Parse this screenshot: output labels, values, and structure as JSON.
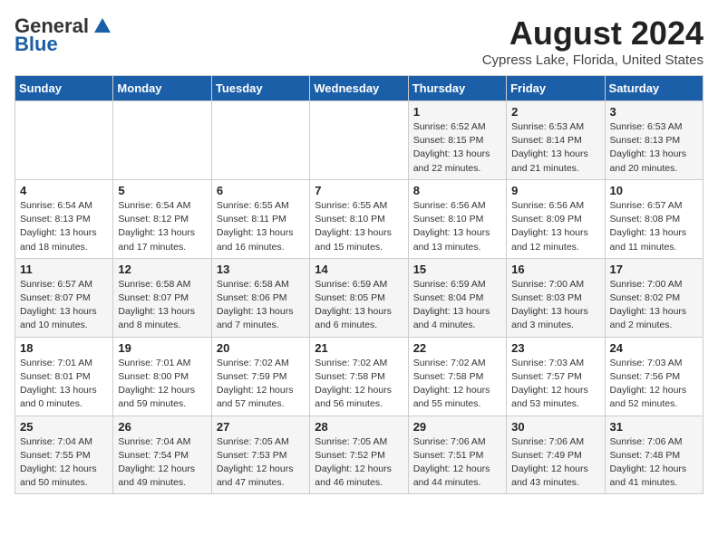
{
  "header": {
    "logo_general": "General",
    "logo_blue": "Blue",
    "title": "August 2024",
    "subtitle": "Cypress Lake, Florida, United States"
  },
  "calendar": {
    "days_of_week": [
      "Sunday",
      "Monday",
      "Tuesday",
      "Wednesday",
      "Thursday",
      "Friday",
      "Saturday"
    ],
    "weeks": [
      [
        {
          "day": "",
          "info": ""
        },
        {
          "day": "",
          "info": ""
        },
        {
          "day": "",
          "info": ""
        },
        {
          "day": "",
          "info": ""
        },
        {
          "day": "1",
          "info": "Sunrise: 6:52 AM\nSunset: 8:15 PM\nDaylight: 13 hours\nand 22 minutes."
        },
        {
          "day": "2",
          "info": "Sunrise: 6:53 AM\nSunset: 8:14 PM\nDaylight: 13 hours\nand 21 minutes."
        },
        {
          "day": "3",
          "info": "Sunrise: 6:53 AM\nSunset: 8:13 PM\nDaylight: 13 hours\nand 20 minutes."
        }
      ],
      [
        {
          "day": "4",
          "info": "Sunrise: 6:54 AM\nSunset: 8:13 PM\nDaylight: 13 hours\nand 18 minutes."
        },
        {
          "day": "5",
          "info": "Sunrise: 6:54 AM\nSunset: 8:12 PM\nDaylight: 13 hours\nand 17 minutes."
        },
        {
          "day": "6",
          "info": "Sunrise: 6:55 AM\nSunset: 8:11 PM\nDaylight: 13 hours\nand 16 minutes."
        },
        {
          "day": "7",
          "info": "Sunrise: 6:55 AM\nSunset: 8:10 PM\nDaylight: 13 hours\nand 15 minutes."
        },
        {
          "day": "8",
          "info": "Sunrise: 6:56 AM\nSunset: 8:10 PM\nDaylight: 13 hours\nand 13 minutes."
        },
        {
          "day": "9",
          "info": "Sunrise: 6:56 AM\nSunset: 8:09 PM\nDaylight: 13 hours\nand 12 minutes."
        },
        {
          "day": "10",
          "info": "Sunrise: 6:57 AM\nSunset: 8:08 PM\nDaylight: 13 hours\nand 11 minutes."
        }
      ],
      [
        {
          "day": "11",
          "info": "Sunrise: 6:57 AM\nSunset: 8:07 PM\nDaylight: 13 hours\nand 10 minutes."
        },
        {
          "day": "12",
          "info": "Sunrise: 6:58 AM\nSunset: 8:07 PM\nDaylight: 13 hours\nand 8 minutes."
        },
        {
          "day": "13",
          "info": "Sunrise: 6:58 AM\nSunset: 8:06 PM\nDaylight: 13 hours\nand 7 minutes."
        },
        {
          "day": "14",
          "info": "Sunrise: 6:59 AM\nSunset: 8:05 PM\nDaylight: 13 hours\nand 6 minutes."
        },
        {
          "day": "15",
          "info": "Sunrise: 6:59 AM\nSunset: 8:04 PM\nDaylight: 13 hours\nand 4 minutes."
        },
        {
          "day": "16",
          "info": "Sunrise: 7:00 AM\nSunset: 8:03 PM\nDaylight: 13 hours\nand 3 minutes."
        },
        {
          "day": "17",
          "info": "Sunrise: 7:00 AM\nSunset: 8:02 PM\nDaylight: 13 hours\nand 2 minutes."
        }
      ],
      [
        {
          "day": "18",
          "info": "Sunrise: 7:01 AM\nSunset: 8:01 PM\nDaylight: 13 hours\nand 0 minutes."
        },
        {
          "day": "19",
          "info": "Sunrise: 7:01 AM\nSunset: 8:00 PM\nDaylight: 12 hours\nand 59 minutes."
        },
        {
          "day": "20",
          "info": "Sunrise: 7:02 AM\nSunset: 7:59 PM\nDaylight: 12 hours\nand 57 minutes."
        },
        {
          "day": "21",
          "info": "Sunrise: 7:02 AM\nSunset: 7:58 PM\nDaylight: 12 hours\nand 56 minutes."
        },
        {
          "day": "22",
          "info": "Sunrise: 7:02 AM\nSunset: 7:58 PM\nDaylight: 12 hours\nand 55 minutes."
        },
        {
          "day": "23",
          "info": "Sunrise: 7:03 AM\nSunset: 7:57 PM\nDaylight: 12 hours\nand 53 minutes."
        },
        {
          "day": "24",
          "info": "Sunrise: 7:03 AM\nSunset: 7:56 PM\nDaylight: 12 hours\nand 52 minutes."
        }
      ],
      [
        {
          "day": "25",
          "info": "Sunrise: 7:04 AM\nSunset: 7:55 PM\nDaylight: 12 hours\nand 50 minutes."
        },
        {
          "day": "26",
          "info": "Sunrise: 7:04 AM\nSunset: 7:54 PM\nDaylight: 12 hours\nand 49 minutes."
        },
        {
          "day": "27",
          "info": "Sunrise: 7:05 AM\nSunset: 7:53 PM\nDaylight: 12 hours\nand 47 minutes."
        },
        {
          "day": "28",
          "info": "Sunrise: 7:05 AM\nSunset: 7:52 PM\nDaylight: 12 hours\nand 46 minutes."
        },
        {
          "day": "29",
          "info": "Sunrise: 7:06 AM\nSunset: 7:51 PM\nDaylight: 12 hours\nand 44 minutes."
        },
        {
          "day": "30",
          "info": "Sunrise: 7:06 AM\nSunset: 7:49 PM\nDaylight: 12 hours\nand 43 minutes."
        },
        {
          "day": "31",
          "info": "Sunrise: 7:06 AM\nSunset: 7:48 PM\nDaylight: 12 hours\nand 41 minutes."
        }
      ]
    ]
  }
}
